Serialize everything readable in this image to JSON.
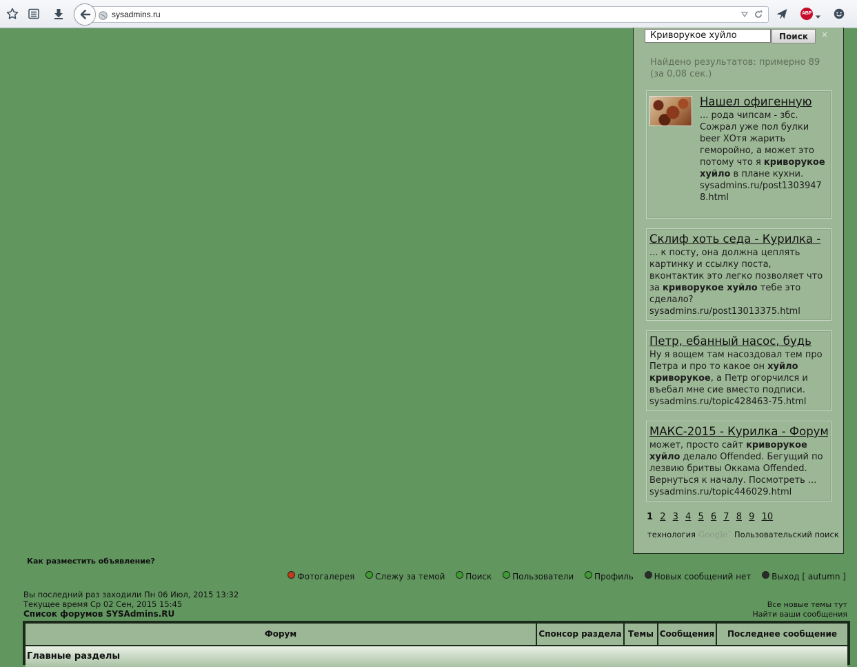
{
  "browser": {
    "url": "sysadmins.ru"
  },
  "search": {
    "query": "Криворукое хуйло",
    "button_label": "Поиск",
    "clear_symbol": "×",
    "stats": "Найдено результатов: примерно 89 (за 0,08 сек.)",
    "results": [
      {
        "title": "Нашел офигенную",
        "text_before": "... рода чипсам - збс. Сожрал уже пол булки beer ХОтя жарить геморойно, а может это потому что я ",
        "bold": "криворукое хуйло",
        "text_after": " в плане кухни.",
        "url": "sysadmins.ru/post13039478.html"
      },
      {
        "title": "Склиф хоть седа - Курилка -",
        "text_before": "... к посту, она должна цеплять картинку и ссылку поста, вконтактик это легко позволяет что за ",
        "bold": "криворукое хуйло",
        "text_after": " тебе это сделало?",
        "url": "sysadmins.ru/post13013375.html"
      },
      {
        "title": "Петр, ебанный насос, будь",
        "text_before": "Ну я вощем там насоздовал тем про Петра и про то какое он ",
        "bold": "хуйло криворукое",
        "text_after": ", а Петр огорчился и въебал мне сие вместо подписи.",
        "url": "sysadmins.ru/topic428463-75.html"
      },
      {
        "title": "МАКС-2015 - Курилка - Форум",
        "text_before": "может, просто сайт ",
        "bold": "криворукое хуйло",
        "text_after": " делало Offended. Бегущий по лезвию бритвы Оккама Offended. Вернуться к началу. Посмотреть ...",
        "url": "sysadmins.ru/topic446029.html"
      }
    ],
    "pages": [
      "1",
      "2",
      "3",
      "4",
      "5",
      "6",
      "7",
      "8",
      "9",
      "10"
    ],
    "branding_prefix": "технология",
    "branding_logo": "Google",
    "branding_suffix": "Пользовательский поиск"
  },
  "forum": {
    "ad_link": "Как разместить объявление?",
    "menu": [
      {
        "label": "Фотогалерея",
        "color": "#c53a1c"
      },
      {
        "label": "Слежу за темой",
        "color": "#3f9c32"
      },
      {
        "label": "Поиск",
        "color": "#3f9c32"
      },
      {
        "label": "Пользователи",
        "color": "#3f9c32"
      },
      {
        "label": "Профиль",
        "color": "#3f9c32"
      },
      {
        "label": "Новых сообщений нет",
        "color": "#2b2b2b"
      },
      {
        "label": "Выход [ autumn ]",
        "color": "#2b2b2b"
      }
    ],
    "last_visit": "Вы последний раз заходили Пн 06 Июл, 2015 13:32",
    "current_time": "Текущее время Ср 02 Сен, 2015 15:45",
    "index_link": "Список форумов SYSAdmins.RU",
    "all_new_topics": "Все новые темы тут",
    "find_your_posts": "Найти ваши сообщения",
    "table_headers": [
      "Форум",
      "Спонсор раздела",
      "Темы",
      "Сообщения",
      "Последнее сообщение"
    ],
    "category": "Главные разделы"
  }
}
